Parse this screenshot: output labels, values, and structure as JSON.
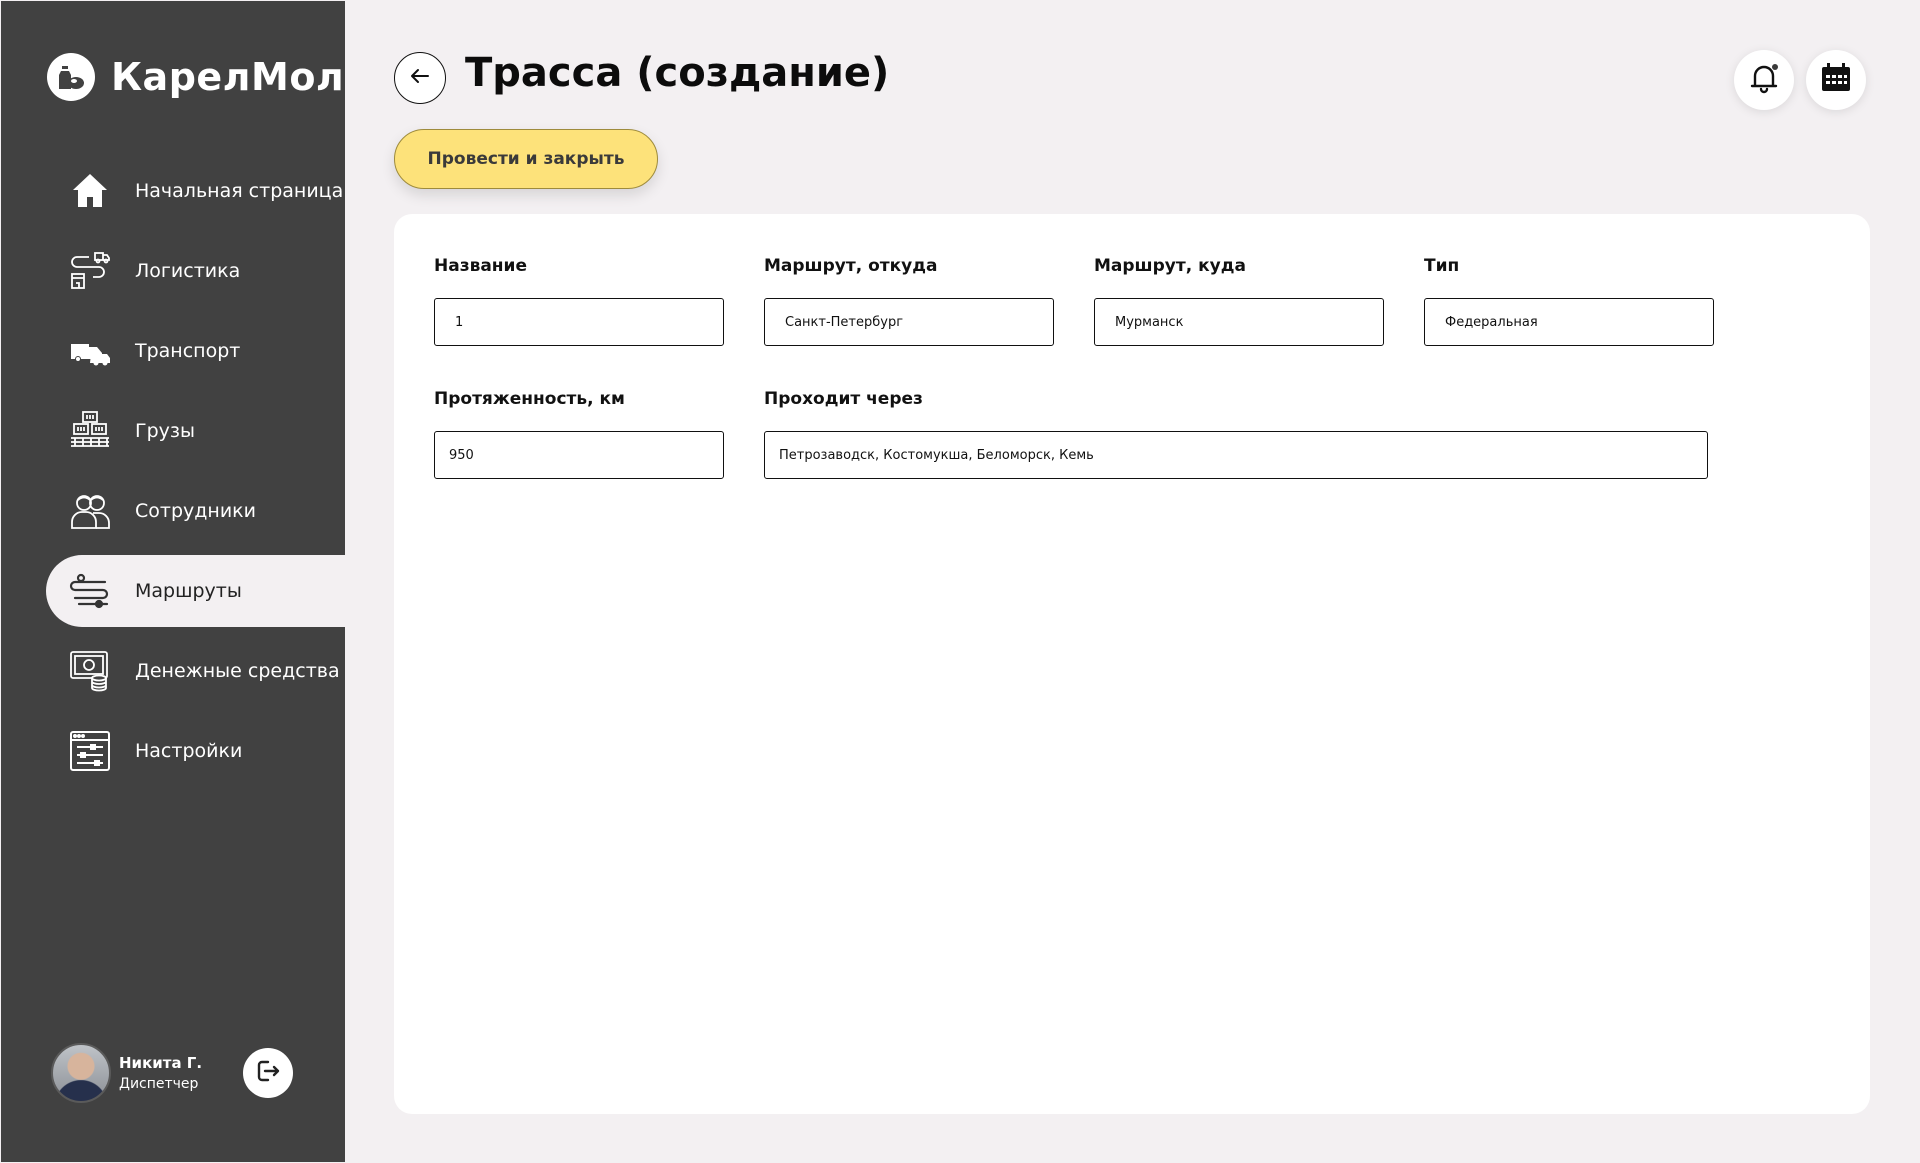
{
  "app": {
    "name": "КарелМол"
  },
  "sidebar": {
    "items": [
      {
        "label": "Начальная страница",
        "icon": "home-icon",
        "active": false
      },
      {
        "label": "Логистика",
        "icon": "logistics-icon",
        "active": false
      },
      {
        "label": "Транспорт",
        "icon": "vehicles-icon",
        "active": false
      },
      {
        "label": "Грузы",
        "icon": "cargo-icon",
        "active": false
      },
      {
        "label": "Сотрудники",
        "icon": "employees-icon",
        "active": false
      },
      {
        "label": "Маршруты",
        "icon": "routes-icon",
        "active": true
      },
      {
        "label": "Денежные средства",
        "icon": "money-icon",
        "active": false
      },
      {
        "label": "Настройки",
        "icon": "settings-icon",
        "active": false
      }
    ]
  },
  "user": {
    "name": "Никита Г.",
    "role": "Диспетчер"
  },
  "header": {
    "title": "Трасса (создание)"
  },
  "actions": {
    "primary_label": "Провести и закрыть"
  },
  "form": {
    "name": {
      "label": "Название",
      "value": "1"
    },
    "route_from": {
      "label": "Маршрут, откуда",
      "value": "Санкт-Петербург"
    },
    "route_to": {
      "label": "Маршрут, куда",
      "value": "Мурманск"
    },
    "type": {
      "label": "Тип",
      "value": "Федеральная"
    },
    "length": {
      "label": "Протяженность, км",
      "value": "950"
    },
    "via": {
      "label": "Проходит через",
      "value": "Петрозаводск, Костомукша, Беломорск, Кемь"
    }
  },
  "colors": {
    "sidebar_bg": "#414141",
    "page_bg": "#f3f0f2",
    "accent": "#fde27a",
    "notification_dot": "#3a3a3a"
  }
}
